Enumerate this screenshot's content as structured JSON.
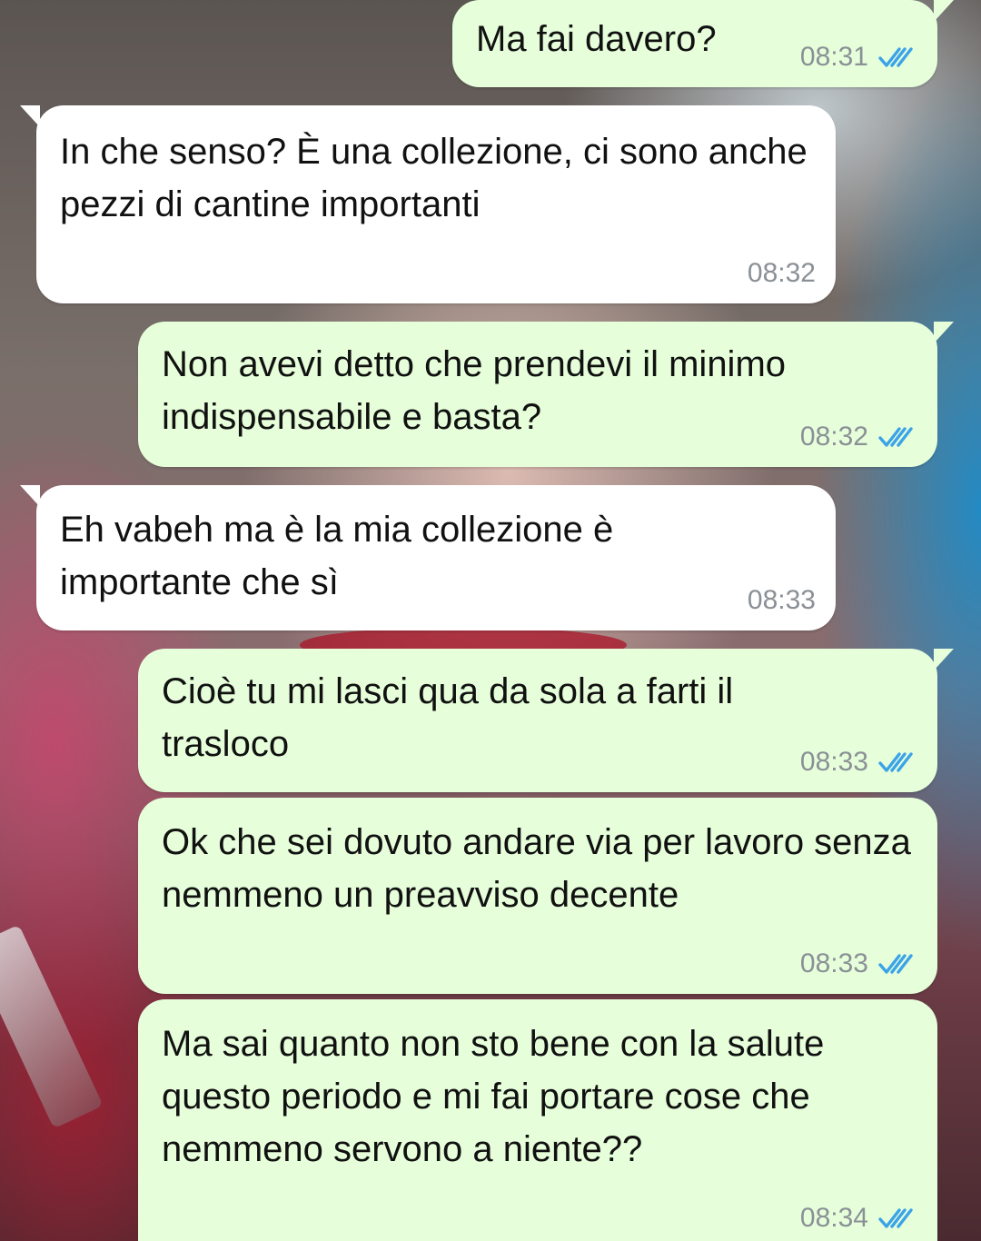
{
  "messages": [
    {
      "direction": "out",
      "text": "Ma fai davero?",
      "time": "08:31",
      "status": "read-double-check-icon"
    },
    {
      "direction": "in",
      "text": "In che senso? È una collezione, ci sono anche pezzi di cantine importanti",
      "time": "08:32"
    },
    {
      "direction": "out",
      "text": "Non avevi detto che prendevi il minimo indispensabile e basta?",
      "time": "08:32",
      "status": "read-double-check-icon"
    },
    {
      "direction": "in",
      "text": "Eh vabeh ma è la mia collezione è importante che sì",
      "time": "08:33"
    },
    {
      "direction": "out",
      "text": "Cioè tu mi lasci qua da sola a farti il trasloco",
      "time": "08:33",
      "status": "read-double-check-icon"
    },
    {
      "direction": "out",
      "text": "Ok che sei dovuto andare via per lavoro senza nemmeno un preavviso decente",
      "time": "08:33",
      "status": "read-double-check-icon"
    },
    {
      "direction": "out",
      "text": "Ma sai quanto non sto bene con la salute questo periodo e mi fai portare cose che nemmeno servono a niente??",
      "time": "08:34",
      "status": "read-double-check-icon"
    }
  ],
  "colors": {
    "outgoing_bubble": "#e6ffda",
    "incoming_bubble": "#ffffff",
    "timestamp": "#8a9096",
    "read_ticks": "#3ba3e8"
  }
}
